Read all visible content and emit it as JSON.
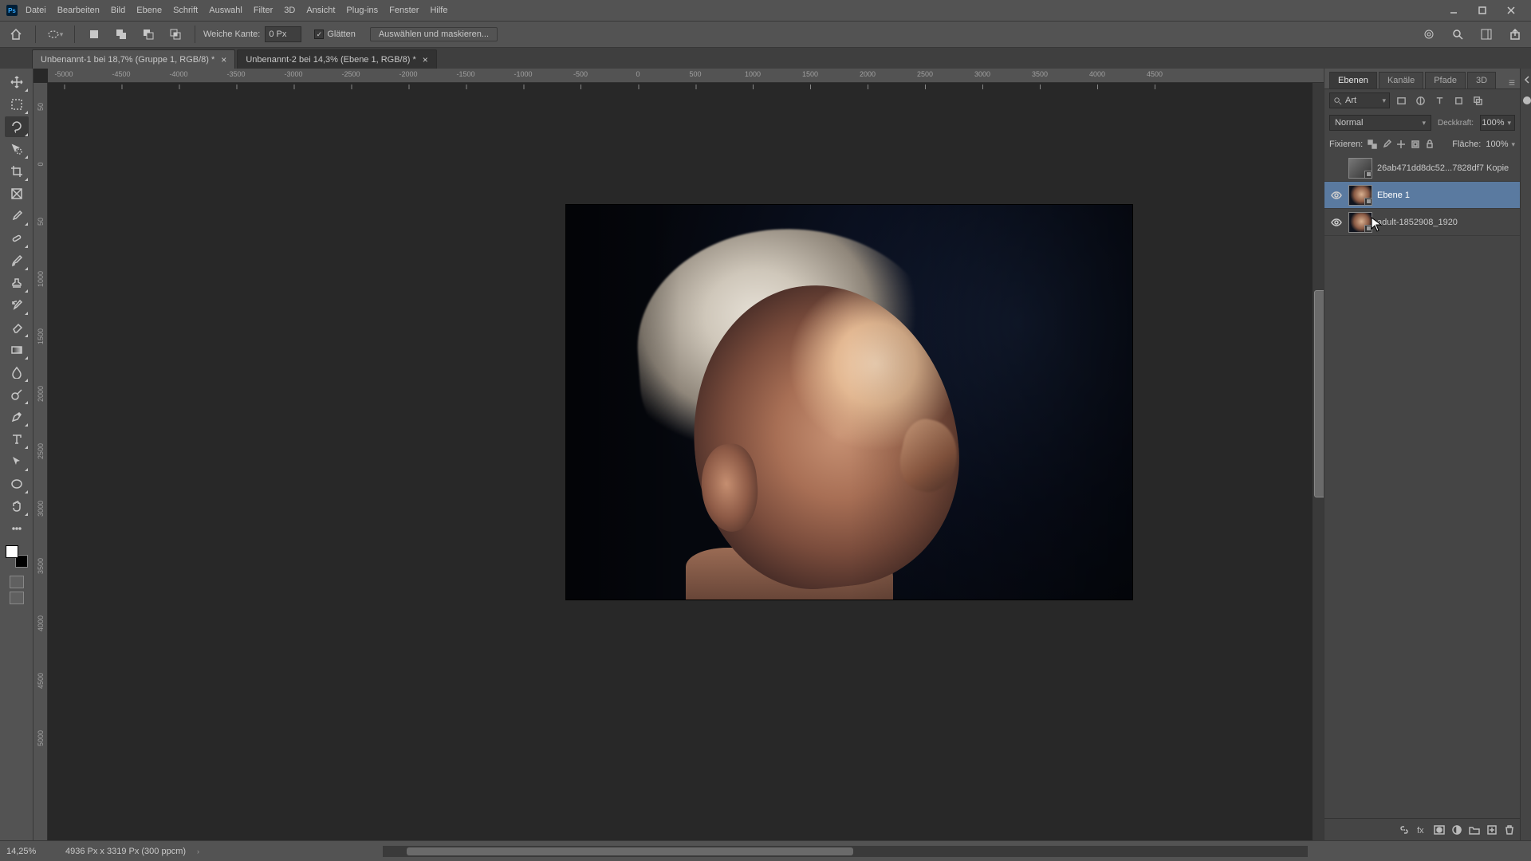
{
  "menu": {
    "items": [
      "Datei",
      "Bearbeiten",
      "Bild",
      "Ebene",
      "Schrift",
      "Auswahl",
      "Filter",
      "3D",
      "Ansicht",
      "Plug-ins",
      "Fenster",
      "Hilfe"
    ]
  },
  "options": {
    "feather_label": "Weiche Kante:",
    "feather_value": "0 Px",
    "antialias_label": "Glätten",
    "select_mask_label": "Auswählen und maskieren..."
  },
  "doc_tabs": [
    {
      "label": "Unbenannt-1 bei 18,7% (Gruppe 1, RGB/8) *",
      "active": false
    },
    {
      "label": "Unbenannt-2 bei 14,3% (Ebene 1, RGB/8) *",
      "active": true
    }
  ],
  "ruler_h": [
    "-5000",
    "-4500",
    "-4000",
    "-3500",
    "-3000",
    "-2500",
    "-2000",
    "-1500",
    "-1000",
    "-500",
    "0",
    "500",
    "1000",
    "1500",
    "2000",
    "2500",
    "3000",
    "3500",
    "4000",
    "4500"
  ],
  "ruler_v": [
    "5\n0",
    "0",
    "5\n0",
    "1\n0\n0\n0",
    "1\n5\n0\n0",
    "2\n0\n0\n0",
    "2\n5\n0\n0",
    "3\n0\n0\n0",
    "3\n5\n0\n0",
    "4\n0\n0\n0",
    "4\n5\n0\n0",
    "5\n0\n0\n0"
  ],
  "panel_tabs": [
    "Ebenen",
    "Kanäle",
    "Pfade",
    "3D"
  ],
  "search_placeholder": "Art",
  "blend": {
    "mode": "Normal",
    "opacity_label": "Deckkraft:",
    "opacity": "100%",
    "lock_label": "Fixieren:",
    "fill_label": "Fläche:",
    "fill": "100%"
  },
  "layers": [
    {
      "name": "26ab471dd8dc52...7828df7 Kopie",
      "visible": false,
      "smart": true,
      "selected": false,
      "thumb": "gray"
    },
    {
      "name": "Ebene 1",
      "visible": true,
      "smart": true,
      "selected": true,
      "thumb": "face"
    },
    {
      "name": "adult-1852908_1920",
      "visible": true,
      "smart": true,
      "selected": false,
      "thumb": "face"
    }
  ],
  "status": {
    "zoom": "14,25%",
    "docinfo": "4936 Px x 3319 Px (300 ppcm)"
  }
}
